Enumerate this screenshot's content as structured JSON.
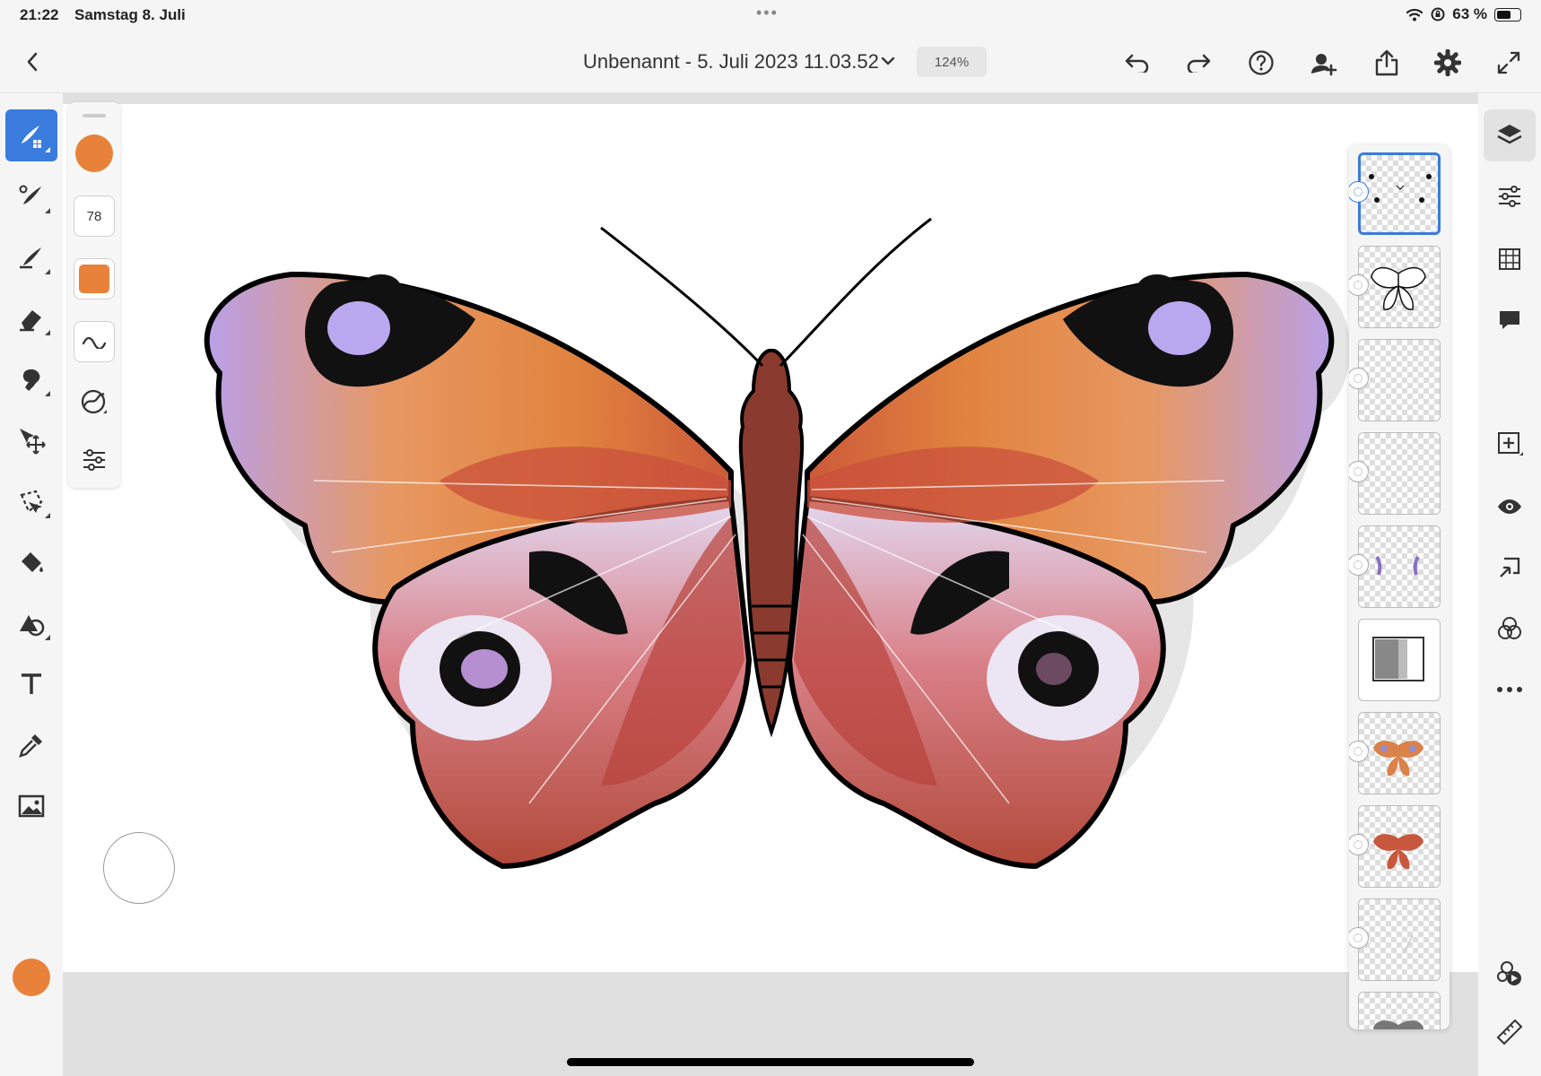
{
  "status": {
    "time": "21:22",
    "date": "Samstag 8. Juli",
    "battery": "63 %",
    "battery_level": 0.63
  },
  "document": {
    "title": "Unbenannt - 5. Juli 2023 11.03.52",
    "zoom": "124%"
  },
  "toolbar_icons": [
    "back-icon",
    "undo-icon",
    "redo-icon",
    "help-icon",
    "invite-icon",
    "share-icon",
    "settings-icon",
    "fullscreen-icon"
  ],
  "left_tools": [
    "pixel-brush-icon",
    "live-brush-icon",
    "vector-brush-icon",
    "eraser-icon",
    "smudge-icon",
    "move-icon",
    "lasso-icon",
    "fill-icon",
    "shapes-icon",
    "text-icon",
    "eyedropper-icon",
    "image-icon"
  ],
  "properties": {
    "brush_size": "78",
    "color": "#e8823a"
  },
  "layers": {
    "count": 10,
    "selected_index": 0
  },
  "right_tools": [
    "layers-icon",
    "adjustments-icon",
    "grid-icon",
    "comment-icon",
    "add-layer-icon",
    "visibility-icon",
    "import-icon",
    "blend-icon",
    "more-icon",
    "livestream-icon",
    "ruler-icon"
  ],
  "colors": {
    "accent": "#3a7bde",
    "brush_color": "#e8823a"
  }
}
